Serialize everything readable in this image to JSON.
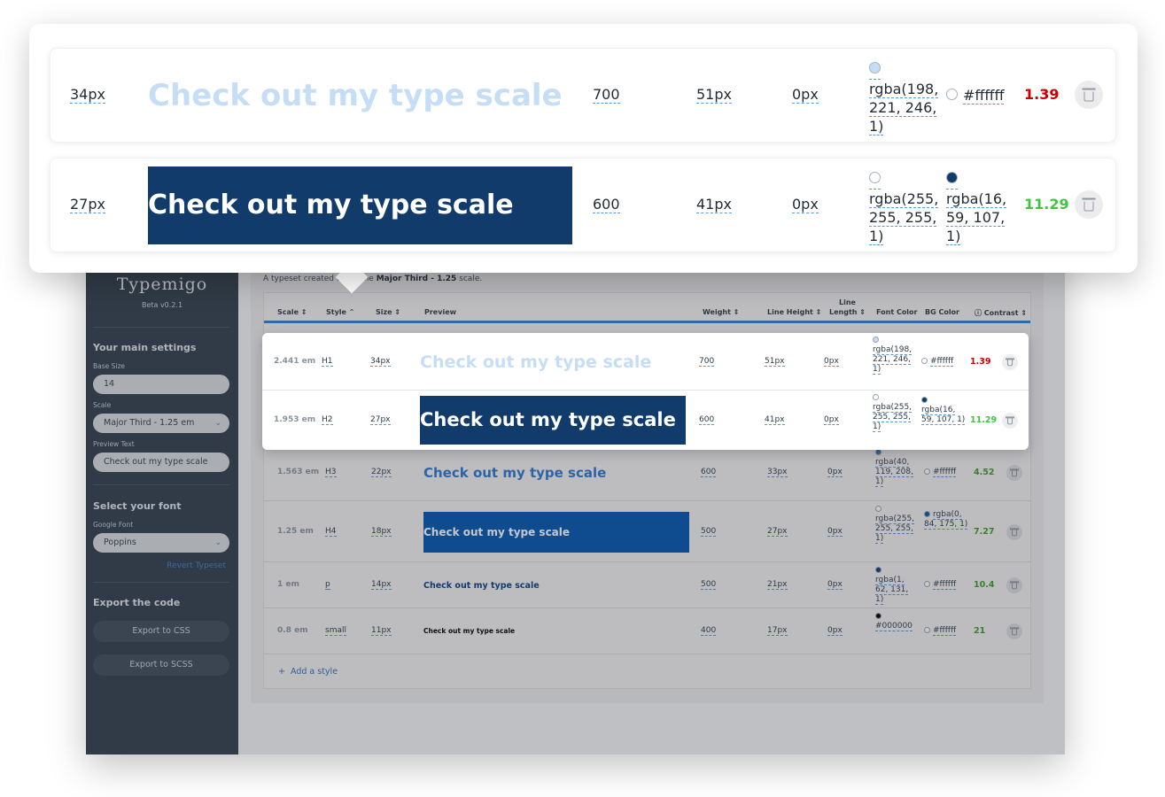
{
  "sidebar": {
    "logo": "Typemigo",
    "version": "Beta v0.2.1",
    "main_settings_heading": "Your main settings",
    "base_size_label": "Base Size",
    "base_size_value": "14",
    "scale_label": "Scale",
    "scale_value": "Major Third - 1.25 em",
    "preview_label": "Preview Text",
    "preview_value": "Check out my type scale",
    "font_heading": "Select your font",
    "google_font_label": "Google Font",
    "google_font_value": "Poppins",
    "revert_link": "Revert Typeset",
    "export_heading": "Export the code",
    "export_css": "Export to CSS",
    "export_scss": "Export to SCSS"
  },
  "description": {
    "prefix": "A typeset created using the",
    "scale": "Major Third - 1.25",
    "suffix": "scale."
  },
  "table": {
    "headers": {
      "scale": "Scale ⇕",
      "style": "Style ⌃",
      "size": "Size ⇕",
      "preview": "Preview",
      "weight": "Weight ⇕",
      "line_height": "Line Height ⇕",
      "line_length_1": "Line",
      "line_length_2": "Length ⇕",
      "font_color": "Font Color",
      "bg_color": "BG Color",
      "contrast": "ⓘ Contrast ⇕"
    },
    "rows": [
      {
        "scale": "2.441 em",
        "style": "H1",
        "size": "34px",
        "preview": "Check out my type scale",
        "weight": "700",
        "line_height": "51px",
        "line_length": "0px",
        "font_color": "rgba(198, 221, 246, 1)",
        "bg_color": "#ffffff",
        "contrast": "1.39",
        "contrast_color": "#c80000",
        "text_color": "#c6ddf6",
        "bg": "#ffffff",
        "dot_font": "#c6ddf6",
        "dot_bg": "#ffffff"
      },
      {
        "scale": "1.953 em",
        "style": "H2",
        "size": "27px",
        "preview": "Check out my type scale",
        "weight": "600",
        "line_height": "41px",
        "line_length": "0px",
        "font_color": "rgba(255, 255, 255, 1)",
        "bg_color": "rgba(16, 59, 107, 1)",
        "contrast": "11.29",
        "contrast_color": "#3fc53f",
        "text_color": "#ffffff",
        "bg": "#103b6b",
        "dot_font": "#ffffff",
        "dot_bg": "#103b6b"
      },
      {
        "scale": "1.563 em",
        "style": "H3",
        "size": "22px",
        "preview": "Check out my type scale",
        "weight": "600",
        "line_height": "33px",
        "line_length": "0px",
        "font_color": "rgba(40, 119, 208, 1)",
        "bg_color": "#ffffff",
        "contrast": "4.52",
        "contrast_color": "#3f9a2a",
        "text_color": "#2877d0",
        "bg": "transparent",
        "dot_font": "#2877d0",
        "dot_bg": "#ffffff"
      },
      {
        "scale": "1.25 em",
        "style": "H4",
        "size": "18px",
        "preview": "Check out my type scale",
        "weight": "500",
        "line_height": "27px",
        "line_length": "0px",
        "font_color": "rgba(255, 255, 255, 1)",
        "bg_color": "rgba(0, 84, 175, 1)",
        "contrast": "7.27",
        "contrast_color": "#3f9a2a",
        "text_color": "#ffffff",
        "bg": "#0054af",
        "dot_font": "#ffffff",
        "dot_bg": "#0054af"
      },
      {
        "scale": "1 em",
        "style": "p",
        "size": "14px",
        "preview": "Check out my type scale",
        "weight": "500",
        "line_height": "21px",
        "line_length": "0px",
        "font_color": "rgba(1, 62, 131, 1)",
        "bg_color": "#ffffff",
        "contrast": "10.4",
        "contrast_color": "#3f9a2a",
        "text_color": "#013e83",
        "bg": "transparent",
        "dot_font": "#013e83",
        "dot_bg": "#ffffff"
      },
      {
        "scale": "0.8 em",
        "style": "small",
        "size": "11px",
        "preview": "Check out my type scale",
        "weight": "400",
        "line_height": "17px",
        "line_length": "0px",
        "font_color": "#000000",
        "bg_color": "#ffffff",
        "contrast": "21",
        "contrast_color": "#3f9a2a",
        "text_color": "#000000",
        "bg": "transparent",
        "dot_font": "#000000",
        "dot_bg": "#ffffff"
      }
    ],
    "add_style": "Add a style"
  },
  "zoom": {
    "rows": [
      {
        "size": "34px",
        "preview": "Check out my type scale",
        "weight": "700",
        "line_height": "51px",
        "line_length": "0px",
        "font_color_lines": [
          "rgba(198,",
          "221, 246,",
          "1)"
        ],
        "bg_color_lines": [
          "#ffffff"
        ],
        "contrast": "1.39",
        "contrast_color": "#c80000",
        "text_color": "#c6ddf6",
        "bg": "#ffffff",
        "dot_font": "#c6ddf6",
        "dot_bg": "#ffffff"
      },
      {
        "size": "27px",
        "preview": "Check out my type scale",
        "weight": "600",
        "line_height": "41px",
        "line_length": "0px",
        "font_color_lines": [
          "rgba(255,",
          "255, 255,",
          "1)"
        ],
        "bg_color_lines": [
          "rgba(16,",
          "59, 107,",
          "1)"
        ],
        "contrast": "11.29",
        "contrast_color": "#3fc53f",
        "text_color": "#ffffff",
        "bg": "#103b6b",
        "dot_font": "#ffffff",
        "dot_bg": "#103b6b"
      }
    ]
  }
}
